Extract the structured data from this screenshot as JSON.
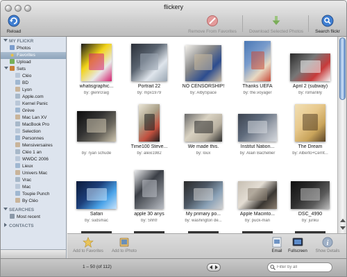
{
  "window": {
    "title": "flickery"
  },
  "toolbar": {
    "reload_label": "Reload",
    "remove_favorites_label": "Remove From Favorites",
    "download_label": "Download Selected Photos",
    "search_label": "Search flickr"
  },
  "sidebar": {
    "my_flickr_header": "MY FLICKR",
    "items": [
      {
        "label": "Photos",
        "icon": "photos-icon"
      },
      {
        "label": "Favorites",
        "icon": "star-icon"
      },
      {
        "label": "Upload",
        "icon": "upload-icon"
      },
      {
        "label": "Sets",
        "icon": "sets-icon"
      }
    ],
    "sets": [
      "Cléo",
      "BD",
      "Lyon",
      "Apple.com",
      "Kernel Panic",
      "Grève",
      "Mac Lan XV",
      "MacBook Pro",
      "Selection",
      "Personnes",
      "Mensiversaires",
      "Cléo 1 an",
      "WWDC 2006",
      "Lieux",
      "Univers Mac",
      "Vrac",
      "Mac",
      "Toupie Punch",
      "By Cléo"
    ],
    "searches_header": "SEARCHES",
    "searches": [
      "Most recent"
    ],
    "contacts_header": "CONTACTS"
  },
  "photos": [
    {
      "title": "whatisgraphic...",
      "by": "by: glenrcraig",
      "palette": [
        "#1a1a1a",
        "#e8e8e8",
        "#d4216f",
        "#f2d319"
      ]
    },
    {
      "title": "Portrait 22",
      "by": "by: mpx1979",
      "palette": [
        "#2a2f38",
        "#dfe5ec",
        "#9aa6b3",
        "#5a6470"
      ]
    },
    {
      "title": "NO CENSORSHIP!",
      "by": "by: AlbySpace",
      "palette": [
        "#f3f1ec",
        "#2d4d8f",
        "#c8b9a0",
        "#888"
      ]
    },
    {
      "title": "Thanks UEFA",
      "by": "by: the.voyager",
      "palette": [
        "#4a78b5",
        "#e8d9c2",
        "#c94c3b",
        "#7a9ccc"
      ]
    },
    {
      "title": "April 2 (subway)",
      "by": "by: romanlily",
      "palette": [
        "#2b2b2b",
        "#c73a3a",
        "#f4f4f4",
        "#777"
      ]
    },
    {
      "title": "",
      "by": "by: ryan schude",
      "palette": [
        "#0d0d0d",
        "#6e6a60",
        "#cfc6b0",
        "#333"
      ]
    },
    {
      "title": "Time100 Steve...",
      "by": "by: alexi1982",
      "palette": [
        "#ece7d8",
        "#c2503f",
        "#1d1d1d",
        "#a99f87"
      ]
    },
    {
      "title": "We made this.",
      "by": "by: loux",
      "palette": [
        "#6b6b6b",
        "#b8b0a0",
        "#2d2d2d",
        "#d9d2c2"
      ]
    },
    {
      "title": "Institut Nation...",
      "by": "by: Alain Bachellier",
      "palette": [
        "#3c4350",
        "#a3a9b3",
        "#d6d9de",
        "#5f6b7c"
      ]
    },
    {
      "title": "The Dream",
      "by": "by: Alberto+Cerrit...",
      "palette": [
        "#f1dfb4",
        "#c9a45b",
        "#5a4327",
        "#e8c98d"
      ]
    },
    {
      "title": "Safari",
      "by": "by: sudsmac",
      "palette": [
        "#0b1a3a",
        "#4aa3e8",
        "#c8e3fb",
        "#1d3f7a"
      ]
    },
    {
      "title": "apple 30 anys",
      "by": "by: Shht!",
      "palette": [
        "#e9eaec",
        "#777b82",
        "#b9bdc4",
        "#3b3f46"
      ]
    },
    {
      "title": "My primary po...",
      "by": "by: washington de...",
      "palette": [
        "#2a2a2a",
        "#8aa1b6",
        "#d1d1d1",
        "#4d5763"
      ]
    },
    {
      "title": "Apple Macinto...",
      "by": "by: puck-man",
      "palette": [
        "#c7bfb3",
        "#3a3632",
        "#8b7f71",
        "#e3ddd3"
      ]
    },
    {
      "title": "DSC_4990",
      "by": "by: junku",
      "palette": [
        "#101010",
        "#5c5c5c",
        "#bdbdbd",
        "#2e2e2e"
      ]
    }
  ],
  "bottombar": {
    "add_favorites_label": "Add to Favorites",
    "add_iphoto_label": "Add to iPhoto",
    "email_label": "Email",
    "fullscreen_label": "Fullscreen",
    "show_details_label": "Show Details"
  },
  "statusbar": {
    "range_text": "1 – 50 (of 112)",
    "filter_placeholder": "Filter by all"
  },
  "colors": {
    "accent": "#5d8ccb",
    "sidebar_bg": "#dde4ee",
    "selection": "#8ea4bb"
  }
}
